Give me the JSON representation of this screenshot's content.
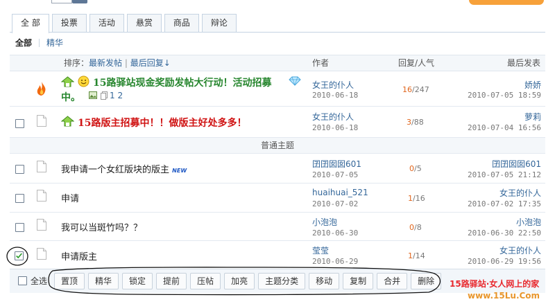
{
  "tabs": [
    {
      "label": "全 部",
      "active": true
    },
    {
      "label": "投票"
    },
    {
      "label": "活动"
    },
    {
      "label": "悬赏"
    },
    {
      "label": "商品"
    },
    {
      "label": "辩论"
    }
  ],
  "subtabs": {
    "all": "全部",
    "digest": "精华"
  },
  "header": {
    "sort_label": "排序：",
    "sort_newest": "最新发帖",
    "sort_sep": "|",
    "sort_last_reply": "最后回复↓",
    "author": "作者",
    "stats": "回复/人气",
    "last_post": "最后发表"
  },
  "pinned": [
    {
      "title_line1": "15路驿站现金奖励发帖大行动！活动招募",
      "title_line2": "中。",
      "pages": "1 2",
      "author": "女王的仆人",
      "date": "2010-06-18",
      "replies": "16",
      "views": "/247",
      "last_user": "娇娇",
      "last_time": "2010-07-05 18:59"
    },
    {
      "title": "15路版主招募中！！做版主好处多多！",
      "author": "女王的仆人",
      "date": "2010-06-18",
      "replies": "3",
      "views": "/88",
      "last_user": "萝莉",
      "last_time": "2010-07-04 16:56"
    }
  ],
  "section_label": "普通主题",
  "threads": [
    {
      "title": "我申请一个女红版块的版主",
      "new_tag": "NEW",
      "author": "囝囝囡囡601",
      "date": "2010-07-05",
      "replies": "0",
      "views": "/5",
      "last_user": "囝囝囡囡601",
      "last_time": "2010-07-05 21:12",
      "checked": false
    },
    {
      "title": "申请",
      "author": "huaihuai_521",
      "date": "2010-07-02",
      "replies": "1",
      "views": "/16",
      "last_user": "女王的仆人",
      "last_time": "2010-07-02 17:35",
      "checked": false
    },
    {
      "title": "我可以当斑竹吗？？",
      "author": "小泡泡",
      "date": "2010-06-30",
      "replies": "0",
      "views": "/8",
      "last_user": "小泡泡",
      "last_time": "2010-06-30 22:50",
      "checked": false
    },
    {
      "title": "申请版主",
      "author": "莹莹",
      "date": "2010-06-29",
      "replies": "1",
      "views": "/14",
      "last_user": "女王的仆人",
      "last_time": "2010-06-29 19:56",
      "checked": true
    }
  ],
  "bottom": {
    "select_all": "全选",
    "actions": [
      "置顶",
      "精华",
      "锁定",
      "提前",
      "压帖",
      "加亮",
      "主题分类",
      "移动",
      "复制",
      "合并",
      "删除"
    ]
  },
  "brand": {
    "line1": "15路驿站·女人网上的家",
    "line2": "www.15Lu.Com"
  },
  "colors": {
    "pinned_green": "#27862e",
    "pinned_red": "#d01414",
    "link": "#336699",
    "reply_count": "#e0651c",
    "annotation": "#111111"
  }
}
